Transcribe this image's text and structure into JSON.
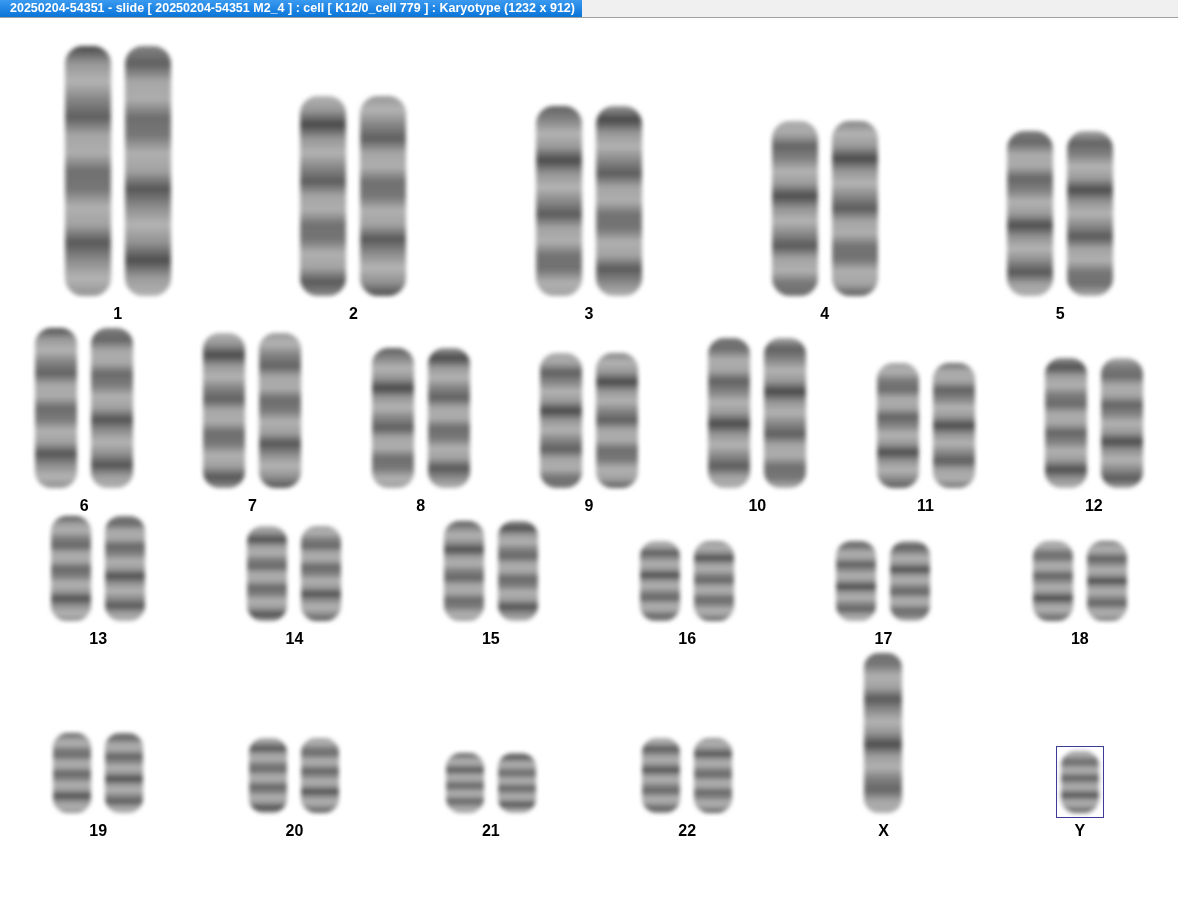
{
  "window": {
    "title": "20250204-54351 - slide [ 20250204-54351 M2_4 ] : cell [ K12/0_cell 779 ] : Karyotype  (1232 x 912)"
  },
  "karyotype": {
    "rows": [
      {
        "chromosomes": [
          {
            "label": "1",
            "kind": "pair",
            "selected": false
          },
          {
            "label": "2",
            "kind": "pair",
            "selected": false
          },
          {
            "label": "3",
            "kind": "pair",
            "selected": false
          },
          {
            "label": "4",
            "kind": "pair",
            "selected": false
          },
          {
            "label": "5",
            "kind": "pair",
            "selected": false
          }
        ]
      },
      {
        "chromosomes": [
          {
            "label": "6",
            "kind": "pair",
            "selected": false
          },
          {
            "label": "7",
            "kind": "pair",
            "selected": false
          },
          {
            "label": "8",
            "kind": "pair",
            "selected": false
          },
          {
            "label": "9",
            "kind": "pair",
            "selected": false
          },
          {
            "label": "10",
            "kind": "pair",
            "selected": false
          },
          {
            "label": "11",
            "kind": "pair",
            "selected": false
          },
          {
            "label": "12",
            "kind": "pair",
            "selected": false
          }
        ]
      },
      {
        "chromosomes": [
          {
            "label": "13",
            "kind": "pair",
            "selected": false
          },
          {
            "label": "14",
            "kind": "pair",
            "selected": false
          },
          {
            "label": "15",
            "kind": "pair",
            "selected": false
          },
          {
            "label": "16",
            "kind": "pair",
            "selected": false
          },
          {
            "label": "17",
            "kind": "pair",
            "selected": false
          },
          {
            "label": "18",
            "kind": "pair",
            "selected": false
          }
        ]
      },
      {
        "chromosomes": [
          {
            "label": "19",
            "kind": "pair",
            "selected": false
          },
          {
            "label": "20",
            "kind": "pair",
            "selected": false
          },
          {
            "label": "21",
            "kind": "pair",
            "selected": false
          },
          {
            "label": "22",
            "kind": "pair",
            "selected": false
          },
          {
            "label": "X",
            "kind": "single",
            "selected": false
          },
          {
            "label": "Y",
            "kind": "single",
            "selected": true
          }
        ]
      }
    ]
  }
}
